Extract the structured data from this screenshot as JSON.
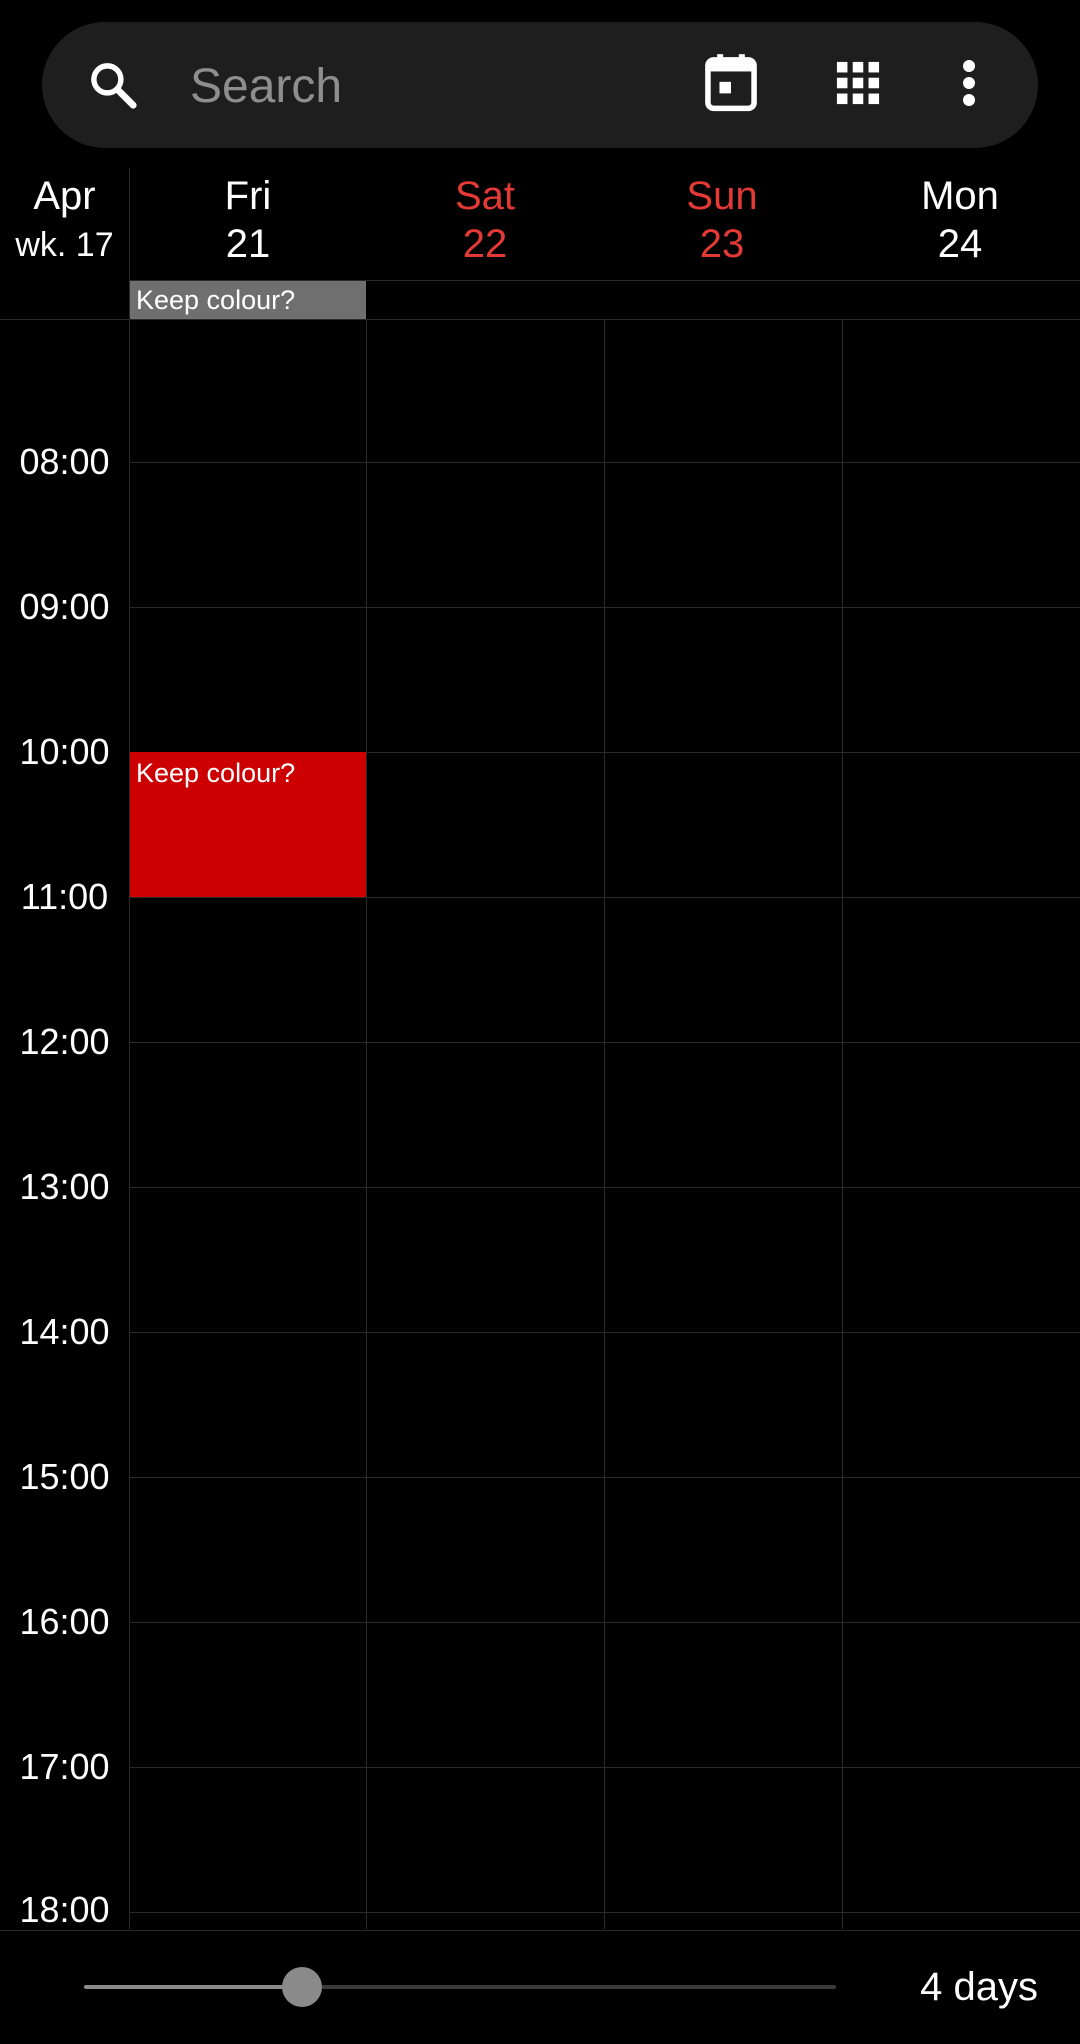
{
  "search": {
    "placeholder": "Search"
  },
  "icons": {
    "search": "search-icon",
    "today": "calendar-today-icon",
    "apps": "apps-grid-icon",
    "more": "more-vert-icon"
  },
  "header": {
    "month": "Apr",
    "week": "wk. 17",
    "days": [
      {
        "name": "Fri",
        "num": "21",
        "weekend": false
      },
      {
        "name": "Sat",
        "num": "22",
        "weekend": true
      },
      {
        "name": "Sun",
        "num": "23",
        "weekend": true
      },
      {
        "name": "Mon",
        "num": "24",
        "weekend": false
      }
    ]
  },
  "all_day_events": [
    {
      "title": "Keep colour?",
      "day": "Fri",
      "color": "#6f6f6f"
    }
  ],
  "hours": [
    "08:00",
    "09:00",
    "10:00",
    "11:00",
    "12:00",
    "13:00",
    "14:00",
    "15:00",
    "16:00",
    "17:00",
    "18:00"
  ],
  "events": [
    {
      "title": "Keep colour?",
      "day": "Fri",
      "start": "10:00",
      "end": "11:00",
      "color": "#cc0000"
    }
  ],
  "footer": {
    "days_label": "4 days",
    "slider_fraction": 0.29
  },
  "colors": {
    "weekend": "#e53935",
    "background": "#000000",
    "search_bg": "#1e1e1e"
  }
}
